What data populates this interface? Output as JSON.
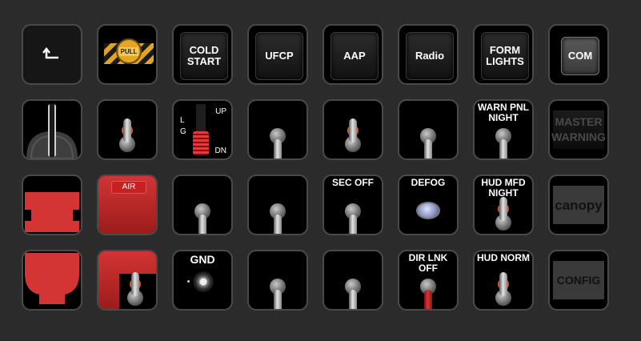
{
  "panel": {
    "back_icon": "return-arrow-icon",
    "row1": {
      "pull_label": "PULL",
      "cold_start": "COLD\nSTART",
      "ufcp": "UFCP",
      "aap": "AAP",
      "radio": "Radio",
      "form_lights": "FORM\nLIGHTS",
      "com": "COM"
    },
    "row2": {
      "gear_l": "L\nG",
      "gear_up": "UP",
      "gear_dn": "DN",
      "warn_pnl_night": "WARN PNL\nNIGHT",
      "master_warning": "MASTER\nWARNING"
    },
    "row3": {
      "air_tag": "AIR",
      "sec_off": "SEC OFF",
      "defog": "DEFOG",
      "hud_mfd_night": "HUD MFD\nNIGHT",
      "canopy": "canopy"
    },
    "row4": {
      "gnd": "GND",
      "dir_lnk_off": "DIR LNK\nOFF",
      "hud_norm": "HUD NORM",
      "config": "CONFIG"
    }
  },
  "colors": {
    "background": "#2b2b2b",
    "key_border": "#4a4a4a",
    "guard_orange": "#d65a1a",
    "cover_red": "#d33434"
  }
}
